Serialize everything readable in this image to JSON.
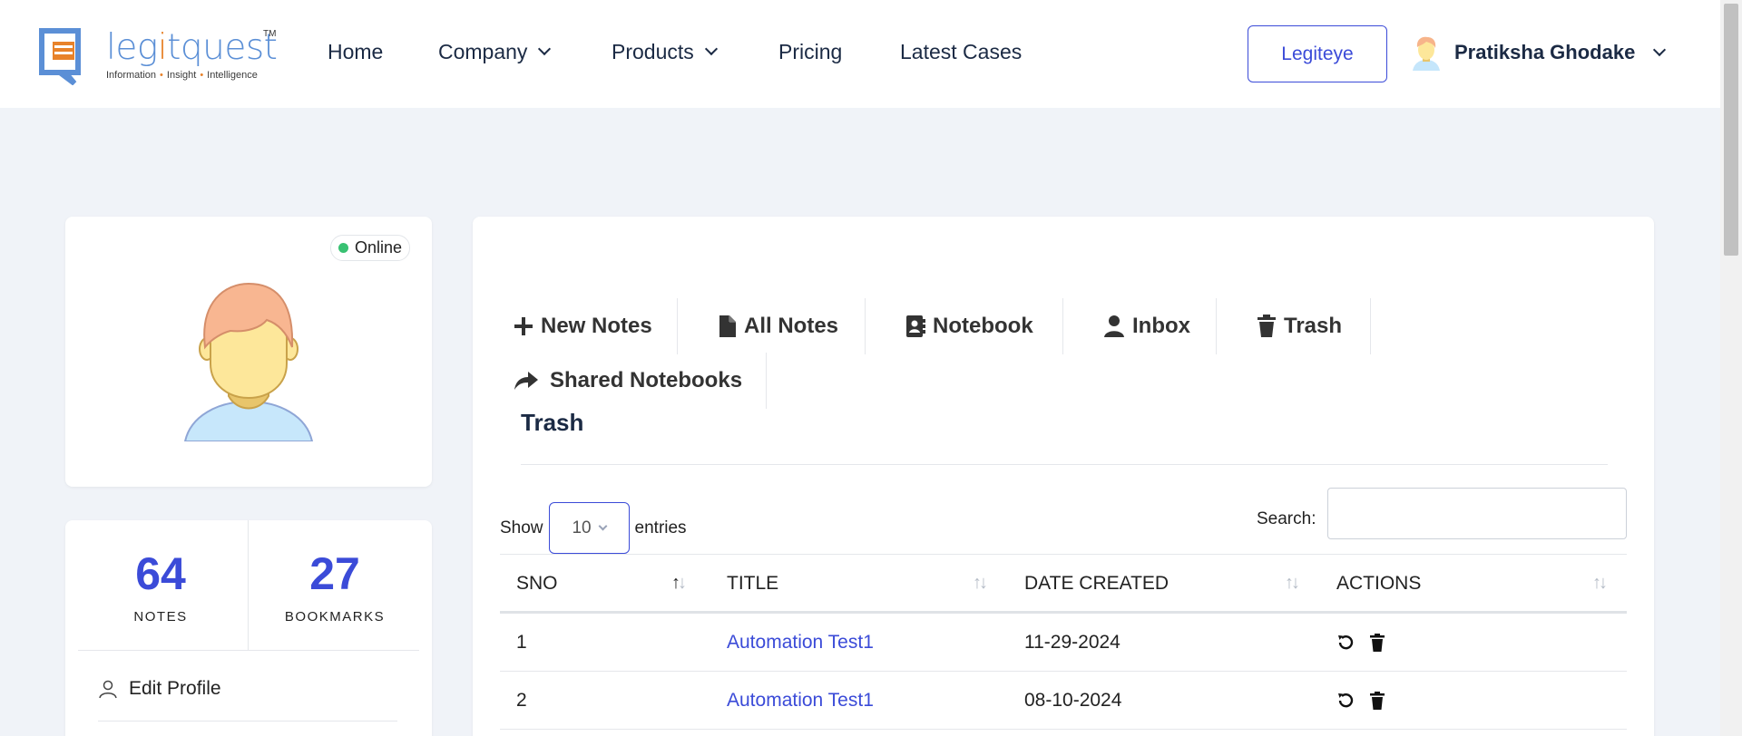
{
  "header": {
    "logo": {
      "word_left": "leg",
      "word_i": "i",
      "word_right": "tquest",
      "tm": "TM",
      "tag1": "Information",
      "tag2": "Insight",
      "tag3": "Intelligence"
    },
    "nav": [
      {
        "label": "Home",
        "dropdown": false
      },
      {
        "label": "Company",
        "dropdown": true
      },
      {
        "label": "Products",
        "dropdown": true
      },
      {
        "label": "Pricing",
        "dropdown": false
      },
      {
        "label": "Latest Cases",
        "dropdown": false
      }
    ],
    "legiteye_label": "Legiteye",
    "user_name": "Pratiksha Ghodake"
  },
  "profile": {
    "status": "Online",
    "status_color": "#38c172"
  },
  "stats": {
    "notes_count": "64",
    "notes_label": "NOTES",
    "bookmarks_count": "27",
    "bookmarks_label": "BOOKMARKS",
    "edit_profile_label": "Edit Profile"
  },
  "tabs": [
    {
      "label": "New Notes",
      "icon": "plus-icon"
    },
    {
      "label": "All Notes",
      "icon": "file-icon"
    },
    {
      "label": "Notebook",
      "icon": "address-book-icon"
    },
    {
      "label": "Inbox",
      "icon": "user-icon"
    },
    {
      "label": "Trash",
      "icon": "trash-icon"
    },
    {
      "label": "Shared Notebooks",
      "icon": "share-icon"
    }
  ],
  "section_title": "Trash",
  "table_controls": {
    "show_label": "Show",
    "entries_value": "10",
    "entries_label": "entries",
    "search_label": "Search:",
    "search_value": ""
  },
  "table": {
    "columns": [
      "SNO",
      "TITLE",
      "DATE CREATED",
      "ACTIONS"
    ],
    "rows": [
      {
        "sno": "1",
        "title": "Automation Test1",
        "date": "11-29-2024"
      },
      {
        "sno": "2",
        "title": "Automation Test1",
        "date": "08-10-2024"
      }
    ]
  },
  "colors": {
    "accent": "#3b4bd8",
    "logo_blue": "#5b8fd6",
    "logo_orange": "#e8822a",
    "background": "#f0f3f8"
  }
}
